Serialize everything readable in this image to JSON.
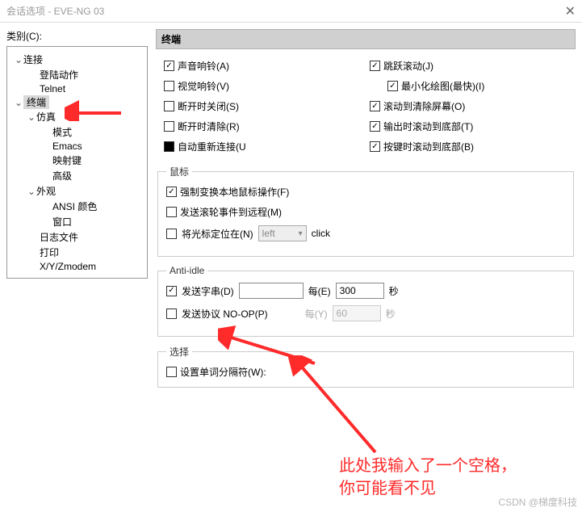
{
  "window": {
    "title": "会话选项 - EVE-NG 03"
  },
  "category_label": "类别(C):",
  "tree": {
    "connection": "连接",
    "login_action": "登陆动作",
    "telnet": "Telnet",
    "terminal": "终端",
    "emulation": "仿真",
    "mode": "模式",
    "emacs": "Emacs",
    "map_keys": "映射键",
    "advanced": "高级",
    "appearance": "外观",
    "ansi_color": "ANSI 颜色",
    "window": "窗口",
    "log_file": "日志文件",
    "print": "打印",
    "xyzmodem": "X/Y/Zmodem"
  },
  "headers": {
    "terminal": "终端"
  },
  "cb": {
    "audio_bell": "声音响铃(A)",
    "visual_bell": "视觉响铃(V)",
    "close_on_disc": "断开时关闭(S)",
    "clear_on_disc": "断开时清除(R)",
    "auto_reconnect": "自动重新连接(U",
    "jump_scroll": "跳跃滚动(J)",
    "min_draw": "最小化绘图(最快)(I)",
    "scroll_clear": "滚动到清除屏幕(O)",
    "scroll_out_bottom": "输出时滚动到底部(T)",
    "scroll_key_bottom": "按键时滚动到底部(B)"
  },
  "mouse": {
    "legend": "鼠标",
    "force_local": "强制变换本地鼠标操作(F)",
    "send_wheel": "发送滚轮事件到远程(M)",
    "place_cursor": "将光标定位在(N)",
    "select_value": "left",
    "click_label": "click"
  },
  "antiidle": {
    "legend": "Anti-idle",
    "send_string": "发送字串(D)",
    "every_label": "每(E)",
    "every_value": "300",
    "seconds": "秒",
    "send_noop": "发送协议 NO-OP(P)",
    "every_y": "每(Y)",
    "noop_value": "60",
    "seconds2": "秒",
    "string_value": " "
  },
  "select": {
    "legend": "选择",
    "word_delim": "设置单词分隔符(W):"
  },
  "annotations": {
    "line1": "此处我输入了一个空格，",
    "line2": "你可能看不见"
  },
  "watermark": "CSDN @梯度科技"
}
